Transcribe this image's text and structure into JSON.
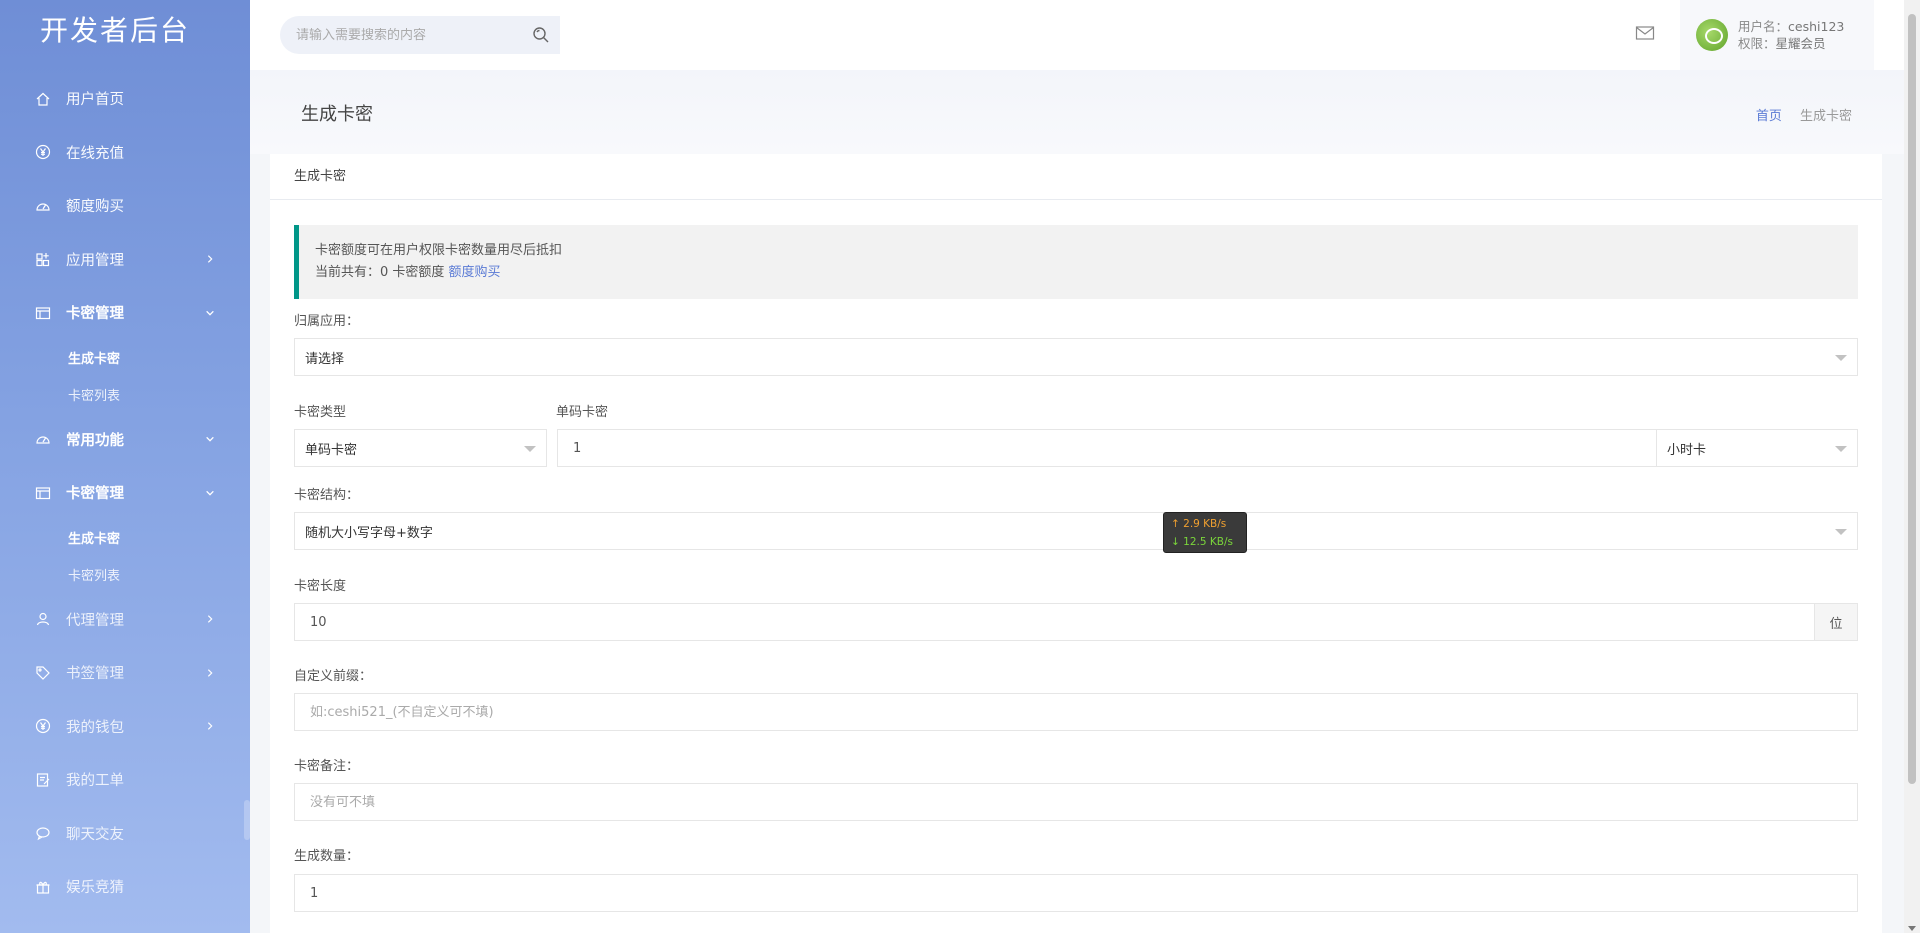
{
  "app": {
    "title": "开发者后台"
  },
  "sidebar": {
    "items": [
      {
        "label": "用户首页",
        "icon": "home-icon"
      },
      {
        "label": "在线充值",
        "icon": "yen-icon"
      },
      {
        "label": "额度购买",
        "icon": "gauge-icon"
      },
      {
        "label": "应用管理",
        "icon": "apps-icon"
      },
      {
        "label": "卡密管理",
        "icon": "card-icon",
        "sub": [
          "生成卡密",
          "卡密列表"
        ]
      },
      {
        "label": "常用功能",
        "icon": "gauge-icon"
      },
      {
        "label": "卡密管理",
        "icon": "card-icon",
        "sub": [
          "生成卡密",
          "卡密列表"
        ]
      },
      {
        "label": "代理管理",
        "icon": "user-icon"
      },
      {
        "label": "书签管理",
        "icon": "tag-icon"
      },
      {
        "label": "我的钱包",
        "icon": "yen-icon"
      },
      {
        "label": "我的工单",
        "icon": "ticket-icon"
      },
      {
        "label": "聊天交友",
        "icon": "chat-icon"
      },
      {
        "label": "娱乐竞猜",
        "icon": "gift-icon"
      }
    ]
  },
  "topbar": {
    "search_placeholder": "请输入需要搜索的内容",
    "user": {
      "name_label": "用户名：",
      "name": "ceshi123",
      "role_label": "权限：",
      "role": "星耀会员"
    }
  },
  "page": {
    "title": "生成卡密",
    "breadcrumb": {
      "home": "首页",
      "current": "生成卡密"
    }
  },
  "card": {
    "header": "生成卡密",
    "notice": {
      "line1": "卡密额度可在用户权限卡密数量用尽后抵扣",
      "line2_prefix": "当前共有：0 卡密额度",
      "link": "额度购买"
    }
  },
  "form": {
    "app": {
      "label": "归属应用：",
      "value": "请选择"
    },
    "card_type": {
      "label": "卡密类型",
      "value": "单码卡密"
    },
    "single_card": {
      "label": "单码卡密",
      "value": "1",
      "unit": "小时卡"
    },
    "structure": {
      "label": "卡密结构：",
      "value": "随机大小写字母+数字"
    },
    "length": {
      "label": "卡密长度",
      "value": "10",
      "unit": "位"
    },
    "prefix": {
      "label": "自定义前缀：",
      "placeholder": "如:ceshi521_(不自定义可不填)"
    },
    "remark": {
      "label": "卡密备注：",
      "placeholder": "没有可不填"
    },
    "count": {
      "label": "生成数量：",
      "value": "1"
    }
  },
  "speed_widget": {
    "up": "↑ 2.9 KB/s",
    "down": "↓ 12.5 KB/s"
  },
  "colors": {
    "accent": "#5b7bd5",
    "notice_border": "#009688",
    "speed_up": "#f0a030",
    "speed_down": "#7bd63a"
  }
}
